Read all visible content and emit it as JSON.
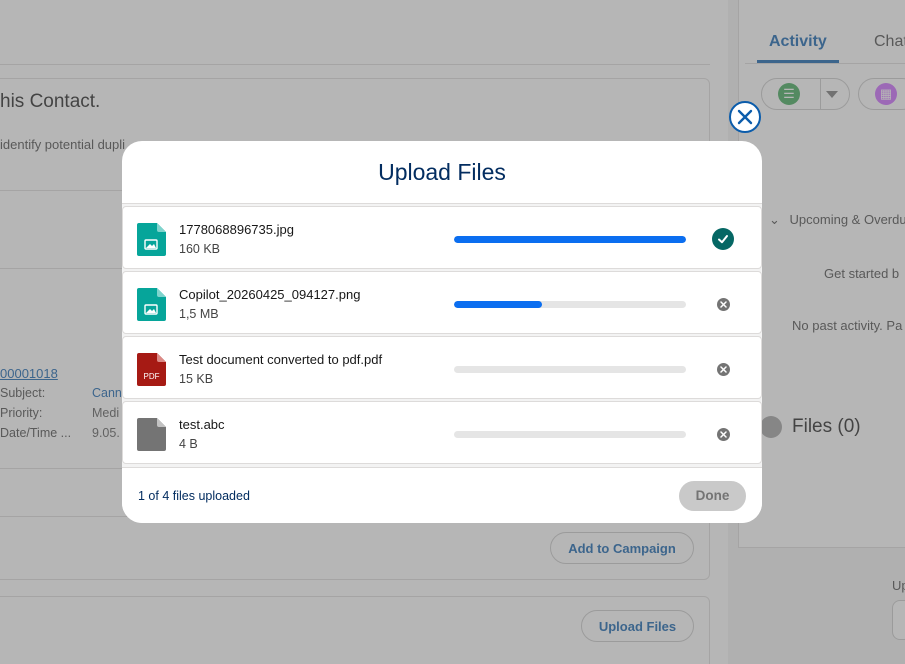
{
  "background": {
    "duplicate_title": "his Contact.",
    "duplicate_desc": "identify potential dupli",
    "case_number": "00001018",
    "fields": [
      {
        "label": "Subject:",
        "value": "Cann"
      },
      {
        "label": "Priority:",
        "value": "Medi"
      },
      {
        "label": "Date/Time ...",
        "value": "9.05."
      }
    ],
    "add_to_campaign": "Add to Campaign",
    "upload_files": "Upload Files",
    "tabs": [
      "Activity",
      "Chat"
    ],
    "upcoming_label": "Upcoming & Overdue",
    "get_started": "Get started b",
    "no_past_activity": "No past activity. Pa",
    "files_label": "Files (0)",
    "upload_partial": "Up"
  },
  "modal": {
    "title": "Upload Files",
    "files": [
      {
        "name": "1778068896735.jpg",
        "size": "160 KB",
        "type": "image",
        "progress": 1.0,
        "status": "complete"
      },
      {
        "name": "Copilot_20260425_094127.png",
        "size": "1,5 MB",
        "type": "image",
        "progress": 0.38,
        "status": "uploading"
      },
      {
        "name": "Test document converted to pdf.pdf",
        "size": "15 KB",
        "type": "pdf",
        "progress": 0,
        "status": "pending"
      },
      {
        "name": "test.abc",
        "size": "4 B",
        "type": "generic",
        "progress": 0,
        "status": "pending"
      }
    ],
    "pdf_icon_text": "PDF",
    "footer_status": "1 of 4 files uploaded",
    "done_label": "Done"
  },
  "colors": {
    "accent": "#0b5cab",
    "progress": "#0b6ef0",
    "success": "#056764",
    "image_icon": "#06a59a",
    "pdf_icon": "#a61a14",
    "generic_icon": "#747474"
  }
}
